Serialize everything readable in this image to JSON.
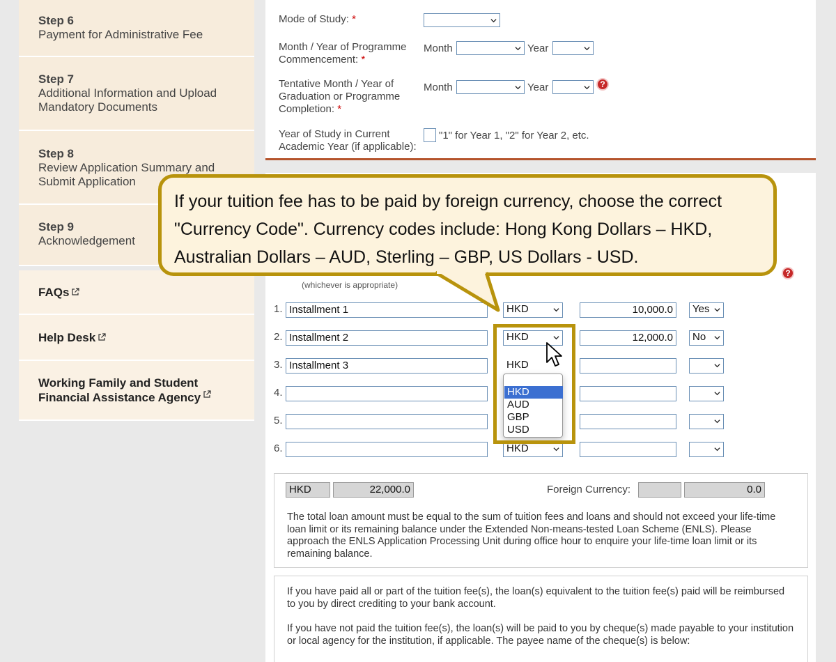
{
  "sidebar": {
    "steps": [
      {
        "title": "Step 6",
        "desc": "Payment for Administrative Fee"
      },
      {
        "title": "Step 7",
        "desc": "Additional Information and Upload Mandatory Documents"
      },
      {
        "title": "Step 8",
        "desc": "Review Application Summary and Submit Application"
      },
      {
        "title": "Step 9",
        "desc": "Acknowledgement"
      }
    ],
    "links": [
      {
        "label": "FAQs"
      },
      {
        "label": "Help Desk"
      },
      {
        "label": "Working Family and Student Financial Assistance Agency"
      }
    ]
  },
  "form": {
    "mode_label": "Mode of Study:",
    "commence_label": "Month / Year of Programme Commencement:",
    "graduation_label": "Tentative Month / Year of Graduation or Programme Completion:",
    "year_of_study_label": "Year of Study in Current Academic Year (if applicable):",
    "year_of_study_hint": "\"1\" for Year 1, \"2\" for Year 2, etc.",
    "month_label": "Month",
    "year_label": "Year",
    "required_mark": "*"
  },
  "installments": {
    "partial_note": "(whichever is appropriate)",
    "rows": [
      {
        "num": "1.",
        "name": "Installment 1",
        "currency": "HKD",
        "amount": "10,000.0",
        "paid": "Yes"
      },
      {
        "num": "2.",
        "name": "Installment 2",
        "currency": "HKD",
        "amount": "12,000.0",
        "paid": "No"
      },
      {
        "num": "3.",
        "name": "Installment 3",
        "currency": "HKD",
        "amount": "",
        "paid": ""
      },
      {
        "num": "4.",
        "name": "",
        "currency": "",
        "amount": "",
        "paid": ""
      },
      {
        "num": "5.",
        "name": "",
        "currency": "",
        "amount": "",
        "paid": ""
      },
      {
        "num": "6.",
        "name": "",
        "currency": "HKD",
        "amount": "",
        "paid": ""
      }
    ],
    "dropdown_options": [
      "HKD",
      "AUD",
      "GBP",
      "USD"
    ],
    "dropdown_selected": "HKD"
  },
  "totals": {
    "currency": "HKD",
    "amount": "22,000.0",
    "foreign_label": "Foreign Currency:",
    "foreign_currency": "",
    "foreign_amount": "0.0",
    "note": "The total loan amount must be equal to the sum of tuition fees and loans and should not exceed your life-time loan limit or its remaining balance under the Extended Non-means-tested Loan Scheme (ENLS). Please approach the ENLS Application Processing Unit during office hour to enquire your life-time loan limit or its remaining balance."
  },
  "payment_info": {
    "para1": "If you have paid all or part of the tuition fee(s), the loan(s) equivalent to the tuition fee(s) paid will be reimbursed to you by direct crediting to your bank account.",
    "para2": "If you have not paid the tuition fee(s), the loan(s) will be paid to you by cheque(s) made payable to your institution or local agency for the institution, if applicable. The payee name of the cheque(s) is below:"
  },
  "callout": {
    "text": "If your tuition fee has to be paid by foreign currency, choose the correct \"Currency Code\". Currency codes include: Hong Kong Dollars – HKD, Australian Dollars – AUD, Sterling – GBP, US Dollars - USD."
  },
  "colors": {
    "accent_border": "#b5542c",
    "callout_border": "#b8930c",
    "dropdown_highlight": "#3b6fd1",
    "sidebar_bg": "#f7ecdc"
  }
}
